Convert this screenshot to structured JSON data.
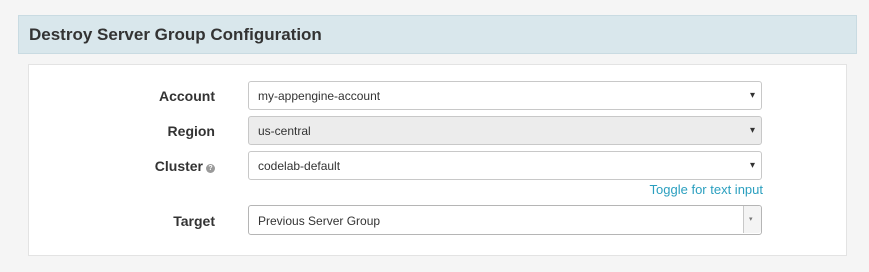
{
  "header": {
    "title": "Destroy Server Group Configuration"
  },
  "form": {
    "account": {
      "label": "Account",
      "value": "my-appengine-account"
    },
    "region": {
      "label": "Region",
      "value": "us-central"
    },
    "cluster": {
      "label": "Cluster",
      "help_glyph": "?",
      "value": "codelab-default"
    },
    "toggle_text_input": "Toggle for text input",
    "target": {
      "label": "Target",
      "value": "Previous Server Group"
    }
  },
  "icons": {
    "caret": "▾",
    "help": "question-circle-icon"
  },
  "colors": {
    "header_background": "#d9e7ec",
    "link": "#2a9fbf",
    "disabled_background": "#ececec"
  }
}
